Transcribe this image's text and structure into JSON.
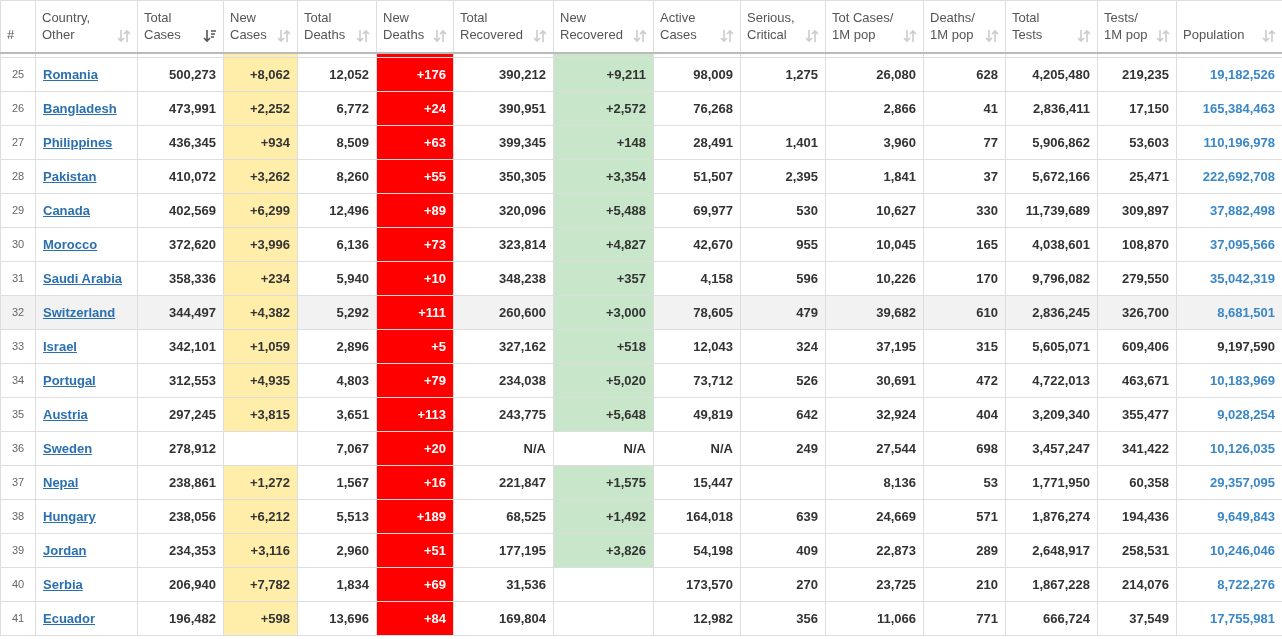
{
  "columns": [
    {
      "label": "#",
      "kind": "rank",
      "sortable": false,
      "sorted": false
    },
    {
      "label": "Country,\nOther",
      "kind": "country",
      "sortable": true,
      "sorted": false
    },
    {
      "label": "Total\nCases",
      "kind": "num",
      "sortable": true,
      "sorted": true
    },
    {
      "label": "New\nCases",
      "kind": "new_cases",
      "sortable": true,
      "sorted": false
    },
    {
      "label": "Total\nDeaths",
      "kind": "num",
      "sortable": true,
      "sorted": false
    },
    {
      "label": "New\nDeaths",
      "kind": "new_deaths",
      "sortable": true,
      "sorted": false
    },
    {
      "label": "Total\nRecovered",
      "kind": "num",
      "sortable": true,
      "sorted": false
    },
    {
      "label": "New\nRecovered",
      "kind": "new_recovered",
      "sortable": true,
      "sorted": false
    },
    {
      "label": "Active\nCases",
      "kind": "num",
      "sortable": true,
      "sorted": false
    },
    {
      "label": "Serious,\nCritical",
      "kind": "num",
      "sortable": true,
      "sorted": false
    },
    {
      "label": "Tot Cases/\n1M pop",
      "kind": "num",
      "sortable": true,
      "sorted": false
    },
    {
      "label": "Deaths/\n1M pop",
      "kind": "num",
      "sortable": true,
      "sorted": false
    },
    {
      "label": "Total\nTests",
      "kind": "num",
      "sortable": true,
      "sorted": false
    },
    {
      "label": "Tests/\n1M pop",
      "kind": "num",
      "sortable": true,
      "sorted": false
    },
    {
      "label": "Population",
      "kind": "population",
      "sortable": true,
      "sorted": false
    }
  ],
  "rows": [
    {
      "rank": "25",
      "country": "Romania",
      "cells": [
        {
          "text": "500,273"
        },
        {
          "text": "+8,062"
        },
        {
          "text": "12,052"
        },
        {
          "text": "+176"
        },
        {
          "text": "390,212"
        },
        {
          "text": "+9,211"
        },
        {
          "text": "98,009"
        },
        {
          "text": "1,275"
        },
        {
          "text": "26,080"
        },
        {
          "text": "628"
        },
        {
          "text": "4,205,480"
        },
        {
          "text": "219,235"
        }
      ],
      "population": "19,182,526",
      "population_link": true,
      "selected": false
    },
    {
      "rank": "26",
      "country": "Bangladesh",
      "cells": [
        {
          "text": "473,991"
        },
        {
          "text": "+2,252"
        },
        {
          "text": "6,772"
        },
        {
          "text": "+24"
        },
        {
          "text": "390,951"
        },
        {
          "text": "+2,572"
        },
        {
          "text": "76,268"
        },
        {},
        {
          "text": "2,866"
        },
        {
          "text": "41"
        },
        {
          "text": "2,836,411"
        },
        {
          "text": "17,150"
        }
      ],
      "population": "165,384,463",
      "population_link": true,
      "selected": false
    },
    {
      "rank": "27",
      "country": "Philippines",
      "cells": [
        {
          "text": "436,345"
        },
        {
          "text": "+934"
        },
        {
          "text": "8,509"
        },
        {
          "text": "+63"
        },
        {
          "text": "399,345"
        },
        {
          "text": "+148"
        },
        {
          "text": "28,491"
        },
        {
          "text": "1,401"
        },
        {
          "text": "3,960"
        },
        {
          "text": "77"
        },
        {
          "text": "5,906,862"
        },
        {
          "text": "53,603"
        }
      ],
      "population": "110,196,978",
      "population_link": true,
      "selected": false
    },
    {
      "rank": "28",
      "country": "Pakistan",
      "cells": [
        {
          "text": "410,072"
        },
        {
          "text": "+3,262"
        },
        {
          "text": "8,260"
        },
        {
          "text": "+55"
        },
        {
          "text": "350,305"
        },
        {
          "text": "+3,354"
        },
        {
          "text": "51,507"
        },
        {
          "text": "2,395"
        },
        {
          "text": "1,841"
        },
        {
          "text": "37"
        },
        {
          "text": "5,672,166"
        },
        {
          "text": "25,471"
        }
      ],
      "population": "222,692,708",
      "population_link": true,
      "selected": false
    },
    {
      "rank": "29",
      "country": "Canada",
      "cells": [
        {
          "text": "402,569"
        },
        {
          "text": "+6,299"
        },
        {
          "text": "12,496"
        },
        {
          "text": "+89"
        },
        {
          "text": "320,096"
        },
        {
          "text": "+5,488"
        },
        {
          "text": "69,977"
        },
        {
          "text": "530"
        },
        {
          "text": "10,627"
        },
        {
          "text": "330"
        },
        {
          "text": "11,739,689"
        },
        {
          "text": "309,897"
        }
      ],
      "population": "37,882,498",
      "population_link": true,
      "selected": false
    },
    {
      "rank": "30",
      "country": "Morocco",
      "cells": [
        {
          "text": "372,620"
        },
        {
          "text": "+3,996"
        },
        {
          "text": "6,136"
        },
        {
          "text": "+73"
        },
        {
          "text": "323,814"
        },
        {
          "text": "+4,827"
        },
        {
          "text": "42,670"
        },
        {
          "text": "955"
        },
        {
          "text": "10,045"
        },
        {
          "text": "165"
        },
        {
          "text": "4,038,601"
        },
        {
          "text": "108,870"
        }
      ],
      "population": "37,095,566",
      "population_link": true,
      "selected": false
    },
    {
      "rank": "31",
      "country": "Saudi Arabia",
      "cells": [
        {
          "text": "358,336"
        },
        {
          "text": "+234"
        },
        {
          "text": "5,940"
        },
        {
          "text": "+10"
        },
        {
          "text": "348,238"
        },
        {
          "text": "+357"
        },
        {
          "text": "4,158"
        },
        {
          "text": "596"
        },
        {
          "text": "10,226"
        },
        {
          "text": "170"
        },
        {
          "text": "9,796,082"
        },
        {
          "text": "279,550"
        }
      ],
      "population": "35,042,319",
      "population_link": true,
      "selected": false
    },
    {
      "rank": "32",
      "country": "Switzerland",
      "cells": [
        {
          "text": "344,497"
        },
        {
          "text": "+4,382"
        },
        {
          "text": "5,292"
        },
        {
          "text": "+111"
        },
        {
          "text": "260,600"
        },
        {
          "text": "+3,000"
        },
        {
          "text": "78,605"
        },
        {
          "text": "479"
        },
        {
          "text": "39,682"
        },
        {
          "text": "610"
        },
        {
          "text": "2,836,245"
        },
        {
          "text": "326,700"
        }
      ],
      "population": "8,681,501",
      "population_link": true,
      "selected": true
    },
    {
      "rank": "33",
      "country": "Israel",
      "cells": [
        {
          "text": "342,101"
        },
        {
          "text": "+1,059"
        },
        {
          "text": "2,896"
        },
        {
          "text": "+5"
        },
        {
          "text": "327,162"
        },
        {
          "text": "+518"
        },
        {
          "text": "12,043"
        },
        {
          "text": "324"
        },
        {
          "text": "37,195"
        },
        {
          "text": "315"
        },
        {
          "text": "5,605,071"
        },
        {
          "text": "609,406"
        }
      ],
      "population": "9,197,590",
      "population_link": false,
      "selected": false
    },
    {
      "rank": "34",
      "country": "Portugal",
      "cells": [
        {
          "text": "312,553"
        },
        {
          "text": "+4,935"
        },
        {
          "text": "4,803"
        },
        {
          "text": "+79"
        },
        {
          "text": "234,038"
        },
        {
          "text": "+5,020"
        },
        {
          "text": "73,712"
        },
        {
          "text": "526"
        },
        {
          "text": "30,691"
        },
        {
          "text": "472"
        },
        {
          "text": "4,722,013"
        },
        {
          "text": "463,671"
        }
      ],
      "population": "10,183,969",
      "population_link": true,
      "selected": false
    },
    {
      "rank": "35",
      "country": "Austria",
      "cells": [
        {
          "text": "297,245"
        },
        {
          "text": "+3,815"
        },
        {
          "text": "3,651"
        },
        {
          "text": "+113"
        },
        {
          "text": "243,775"
        },
        {
          "text": "+5,648"
        },
        {
          "text": "49,819"
        },
        {
          "text": "642"
        },
        {
          "text": "32,924"
        },
        {
          "text": "404"
        },
        {
          "text": "3,209,340"
        },
        {
          "text": "355,477"
        }
      ],
      "population": "9,028,254",
      "population_link": true,
      "selected": false
    },
    {
      "rank": "36",
      "country": "Sweden",
      "cells": [
        {
          "text": "278,912"
        },
        {},
        {
          "text": "7,067"
        },
        {
          "text": "+20"
        },
        {
          "text": "N/A"
        },
        {
          "text": "N/A"
        },
        {
          "text": "N/A"
        },
        {
          "text": "249"
        },
        {
          "text": "27,544"
        },
        {
          "text": "698"
        },
        {
          "text": "3,457,247"
        },
        {
          "text": "341,422"
        }
      ],
      "population": "10,126,035",
      "population_link": true,
      "selected": false
    },
    {
      "rank": "37",
      "country": "Nepal",
      "cells": [
        {
          "text": "238,861"
        },
        {
          "text": "+1,272"
        },
        {
          "text": "1,567"
        },
        {
          "text": "+16"
        },
        {
          "text": "221,847"
        },
        {
          "text": "+1,575"
        },
        {
          "text": "15,447"
        },
        {},
        {
          "text": "8,136"
        },
        {
          "text": "53"
        },
        {
          "text": "1,771,950"
        },
        {
          "text": "60,358"
        }
      ],
      "population": "29,357,095",
      "population_link": true,
      "selected": false
    },
    {
      "rank": "38",
      "country": "Hungary",
      "cells": [
        {
          "text": "238,056"
        },
        {
          "text": "+6,212"
        },
        {
          "text": "5,513"
        },
        {
          "text": "+189"
        },
        {
          "text": "68,525"
        },
        {
          "text": "+1,492"
        },
        {
          "text": "164,018"
        },
        {
          "text": "639"
        },
        {
          "text": "24,669"
        },
        {
          "text": "571"
        },
        {
          "text": "1,876,274"
        },
        {
          "text": "194,436"
        }
      ],
      "population": "9,649,843",
      "population_link": true,
      "selected": false
    },
    {
      "rank": "39",
      "country": "Jordan",
      "cells": [
        {
          "text": "234,353"
        },
        {
          "text": "+3,116"
        },
        {
          "text": "2,960"
        },
        {
          "text": "+51"
        },
        {
          "text": "177,195"
        },
        {
          "text": "+3,826"
        },
        {
          "text": "54,198"
        },
        {
          "text": "409"
        },
        {
          "text": "22,873"
        },
        {
          "text": "289"
        },
        {
          "text": "2,648,917"
        },
        {
          "text": "258,531"
        }
      ],
      "population": "10,246,046",
      "population_link": true,
      "selected": false
    },
    {
      "rank": "40",
      "country": "Serbia",
      "cells": [
        {
          "text": "206,940"
        },
        {
          "text": "+7,782"
        },
        {
          "text": "1,834"
        },
        {
          "text": "+69"
        },
        {
          "text": "31,536"
        },
        {},
        {
          "text": "173,570"
        },
        {
          "text": "270"
        },
        {
          "text": "23,725"
        },
        {
          "text": "210"
        },
        {
          "text": "1,867,228"
        },
        {
          "text": "214,076"
        }
      ],
      "population": "8,722,276",
      "population_link": true,
      "selected": false
    },
    {
      "rank": "41",
      "country": "Ecuador",
      "cells": [
        {
          "text": "196,482"
        },
        {
          "text": "+598"
        },
        {
          "text": "13,696"
        },
        {
          "text": "+84"
        },
        {
          "text": "169,804"
        },
        {},
        {
          "text": "12,982"
        },
        {
          "text": "356"
        },
        {
          "text": "11,066"
        },
        {
          "text": "771"
        },
        {
          "text": "666,724"
        },
        {
          "text": "37,549"
        }
      ],
      "population": "17,755,981",
      "population_link": true,
      "selected": false
    }
  ]
}
